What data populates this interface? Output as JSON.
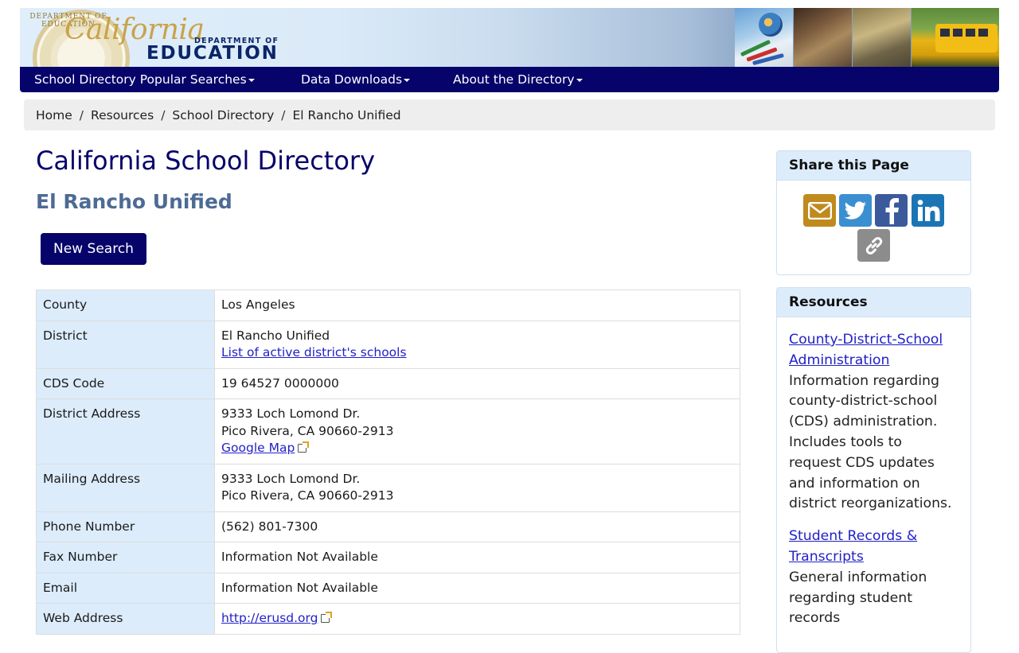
{
  "header": {
    "logo_california": "California",
    "logo_dept": "DEPARTMENT OF",
    "logo_education": "EDUCATION",
    "seal_text": "DEPARTMENT OF EDUCATION"
  },
  "nav": {
    "items": [
      {
        "label": "School Directory Popular Searches"
      },
      {
        "label": "Data Downloads"
      },
      {
        "label": "About the Directory"
      }
    ]
  },
  "breadcrumb": [
    "Home",
    "Resources",
    "School Directory",
    "El Rancho Unified"
  ],
  "page": {
    "title": "California School Directory",
    "subtitle": "El Rancho Unified",
    "new_search_label": "New Search"
  },
  "table": {
    "county": {
      "label": "County",
      "value": "Los Angeles"
    },
    "district": {
      "label": "District",
      "value": "El Rancho Unified",
      "link": "List of active district's schools"
    },
    "cds": {
      "label": "CDS Code",
      "value": "19 64527 0000000"
    },
    "district_address": {
      "label": "District Address",
      "line1": "9333 Loch Lomond Dr.",
      "line2": "Pico Rivera, CA 90660-2913",
      "link": "Google Map"
    },
    "mailing_address": {
      "label": "Mailing Address",
      "line1": "9333 Loch Lomond Dr.",
      "line2": "Pico Rivera, CA 90660-2913"
    },
    "phone": {
      "label": "Phone Number",
      "value": "(562) 801-7300"
    },
    "fax": {
      "label": "Fax Number",
      "value": "Information Not Available"
    },
    "email": {
      "label": "Email",
      "value": "Information Not Available"
    },
    "web": {
      "label": "Web Address",
      "value": "http://erusd.org"
    }
  },
  "sidebar": {
    "share_title": "Share this Page",
    "share_icons": [
      "email-icon",
      "twitter-icon",
      "facebook-icon",
      "linkedin-icon",
      "link-icon"
    ],
    "resources_title": "Resources",
    "resources": [
      {
        "title": "County-District-School Administration",
        "desc": "Information regarding county-district-school (CDS) administration. Includes tools to request CDS updates and information on district reorganizations."
      },
      {
        "title": "Student Records & Transcripts",
        "desc": "General information regarding student records"
      }
    ]
  },
  "colors": {
    "nav_bg": "#06036a",
    "label_bg": "#dcecfb",
    "title": "#06036a",
    "subtitle": "#4d6b93",
    "link": "#2121c8",
    "email_icon": "#c08a1e",
    "twitter_icon": "#3a8fd0",
    "facebook_icon": "#3b5a9c",
    "linkedin_icon": "#1b75b5",
    "link_icon": "#8c8c8c"
  }
}
